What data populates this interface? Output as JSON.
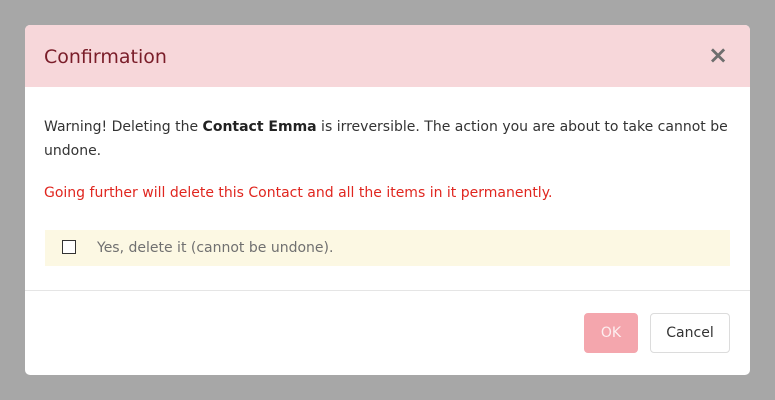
{
  "dialog": {
    "title": "Confirmation",
    "close_symbol": "×",
    "close_icon": "close-icon",
    "warning": {
      "prefix": "Warning! Deleting the ",
      "entity": "Contact Emma",
      "suffix": " is irreversible. The action you are about to take cannot be undone."
    },
    "danger_message": "Going further will delete this Contact and all the items in it permanently.",
    "confirmation": {
      "label": "Yes, delete it (cannot be undone).",
      "checked": false
    },
    "buttons": {
      "ok_label": "OK",
      "cancel_label": "Cancel"
    }
  },
  "colors": {
    "header_bg": "#f7d7da",
    "title_text": "#7a1d29",
    "danger_text": "#e0261f",
    "confirm_bg": "#fcf8e3",
    "ok_bg_disabled": "#f4a6ad",
    "backdrop": "#a7a7a7"
  }
}
